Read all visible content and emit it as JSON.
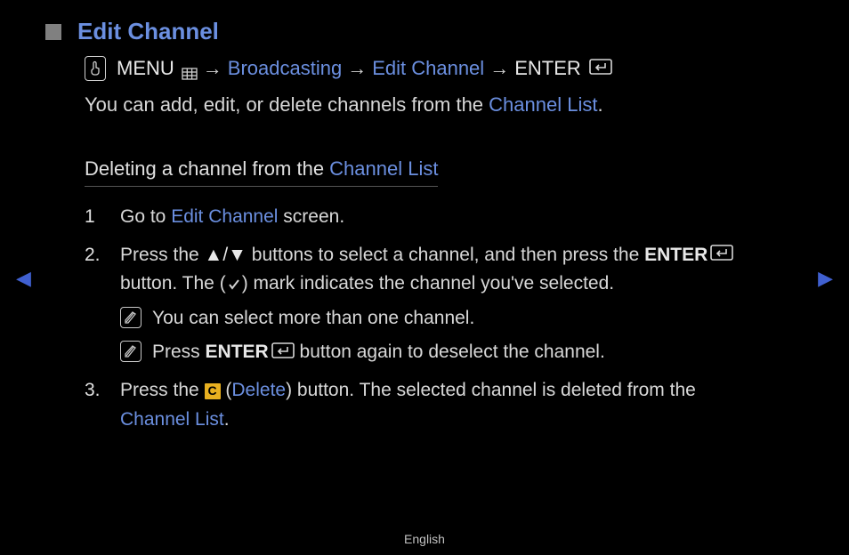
{
  "title": "Edit Channel",
  "nav": {
    "menu": "MENU",
    "broadcasting": "Broadcasting",
    "editChannel": "Edit Channel",
    "enter": "ENTER",
    "arrow": "→"
  },
  "intro": {
    "pre": "You can add, edit, or delete channels from the ",
    "link": "Channel List",
    "post": "."
  },
  "section": {
    "pre": "Deleting a channel from the ",
    "link": "Channel List"
  },
  "steps": {
    "s1": {
      "num": "1",
      "pre": "Go to ",
      "link": "Edit Channel",
      "post": " screen."
    },
    "s2": {
      "num": "2.",
      "t1": "Press the ",
      "updown": "▲/▼",
      "t2": " buttons to select a channel, and then press the ",
      "enter": "ENTER",
      "t3": " button. The (",
      "t4": ") mark indicates the channel you've selected.",
      "note1": "You can select more than one channel.",
      "note2a": "Press ",
      "note2enter": "ENTER",
      "note2b": " button again to deselect the channel."
    },
    "s3": {
      "num": "3.",
      "t1": "Press the ",
      "c": "C",
      "t2": " (",
      "delete": "Delete",
      "t3": ") button. The selected channel is deleted from the ",
      "link": "Channel List",
      "t4": "."
    }
  },
  "footer": {
    "lang": "English"
  },
  "navGlyphs": {
    "prev": "◀",
    "next": "▶"
  }
}
